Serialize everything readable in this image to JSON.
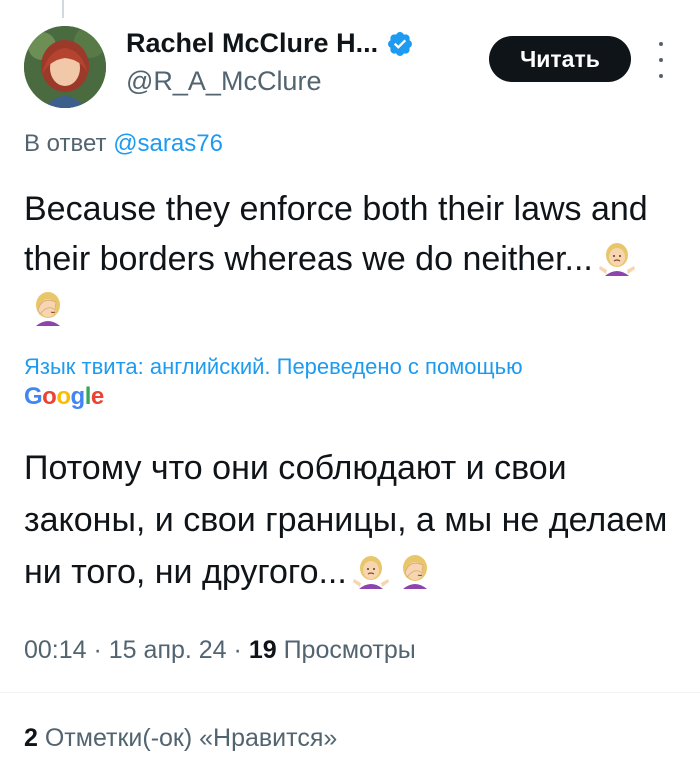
{
  "author": {
    "display_name": "Rachel McClure H...",
    "handle": "@R_A_McClure",
    "verified": true
  },
  "follow_button": {
    "label": "Читать"
  },
  "reply": {
    "prefix": "В ответ",
    "to": "@saras76"
  },
  "tweet": {
    "text": "Because they enforce both their laws and their borders whereas we do neither..."
  },
  "translation": {
    "note": "Язык твита: английский. Переведено с помощью",
    "provider": [
      "G",
      "o",
      "o",
      "g",
      "l",
      "e"
    ],
    "text": "Потому что они соблюдают и свои законы, и свои границы, а мы не делаем ни того, ни другого..."
  },
  "meta": {
    "time": "00:14",
    "separator": " · ",
    "date": "15 апр. 24",
    "views_count": "19",
    "views_label": "Просмотры"
  },
  "likes": {
    "count": "2",
    "label": "Отметки(-ок) «Нравится»"
  },
  "colors": {
    "accent": "#1d9bf0",
    "text": "#0f1419",
    "muted": "#536471"
  },
  "icons": [
    "verified-badge-icon",
    "more-icon",
    "shrug-emoji-icon",
    "facepalm-emoji-icon"
  ]
}
